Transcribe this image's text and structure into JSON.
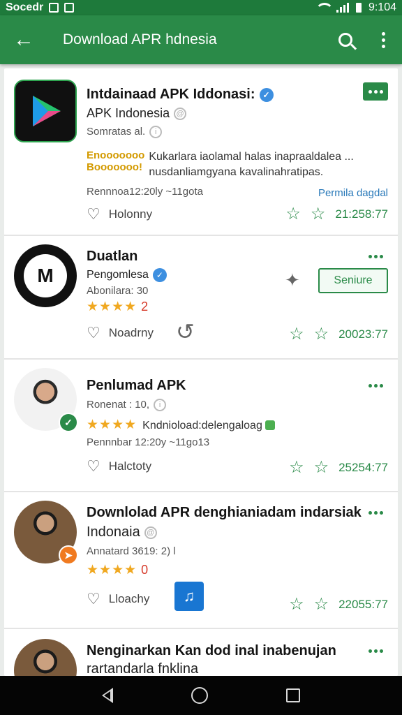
{
  "status_bar": {
    "carrier": "Socedr",
    "time": "9:104"
  },
  "app_bar": {
    "title": "Download APR hdnesia"
  },
  "apps": [
    {
      "title": "Intdainaad APK Iddonasi:",
      "subtitle": "APK Indonesia",
      "meta": "Somratas al.",
      "promo": [
        "Enooooooo",
        "Booooooo!"
      ],
      "description": "Kukarlara iaolamal halas inapraaldalea ... nusdanliamgyana kavalinahratipas.",
      "date": "Rennnoa12:20ly ~11gota",
      "link": "Permila dagdal",
      "fav_label": "Holonny",
      "rating": "21:258:77"
    },
    {
      "title": "Duatlan",
      "subtitle": "Pengomlesa",
      "meta": "Abonilara: 30",
      "stars_count": "2",
      "secure_button": "Seniure",
      "fav_label": "Noadrny",
      "rating": "20023:77"
    },
    {
      "title": "Penlumad APK",
      "meta": "Ronenat : 10,",
      "stars_text": "Kndnioload:delengaloag",
      "date": "Pennnbar 12:20y ~11go13",
      "fav_label": "Halctoty",
      "rating": "25254:77"
    },
    {
      "title": "Downlolad APR denghianiadam indarsiak",
      "subtitle": "Indonaia",
      "meta": "Annatard 3619: 2) l",
      "stars_count": "0",
      "fav_label": "Lloachy",
      "rating": "22055:77"
    },
    {
      "title": "Nenginarkan Kan dod inal inabenujan",
      "subtitle": "rartandarla fnklina"
    }
  ],
  "icons": {
    "back": "arrow-left-icon",
    "search": "search-icon",
    "more": "more-vert-icon",
    "favorite": "heart-icon",
    "star": "star-outline-icon"
  },
  "colors": {
    "primary": "#2a8a48",
    "accent_gold": "#f0a820",
    "link_blue": "#2979b9"
  }
}
